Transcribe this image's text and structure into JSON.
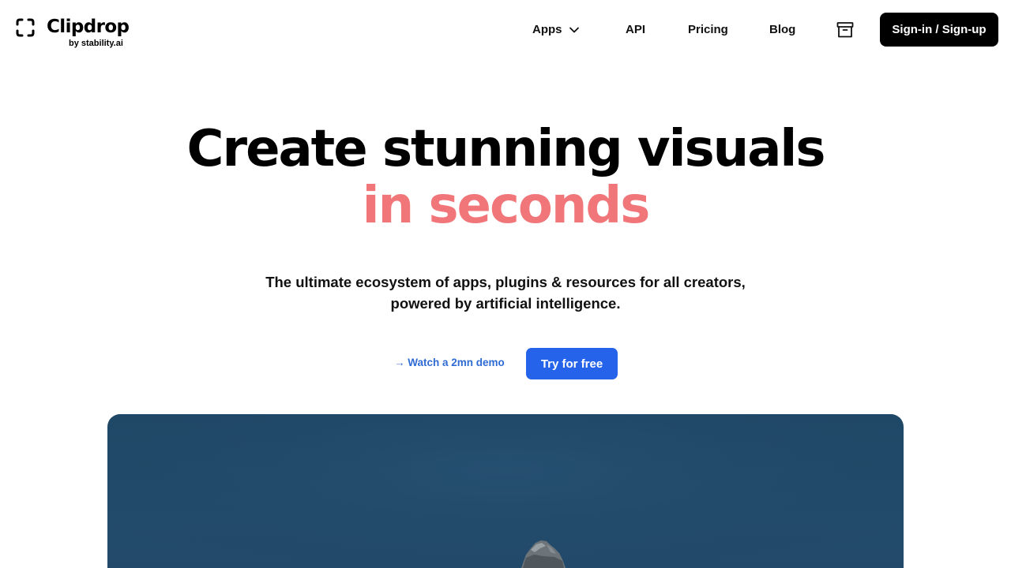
{
  "brand": {
    "name": "Clipdrop",
    "tagline": "by stability.ai",
    "logo_icon": "clipdrop-bracket-icon"
  },
  "nav": {
    "items": [
      {
        "label": "Apps",
        "has_dropdown": true,
        "icon": "chevron-down-icon"
      },
      {
        "label": "API"
      },
      {
        "label": "Pricing"
      },
      {
        "label": "Blog"
      }
    ],
    "archive_icon": "archive-box-icon",
    "signin_label": "Sign-in / Sign-up"
  },
  "hero": {
    "title_line1": "Create stunning visuals",
    "title_line2": "in seconds",
    "subtitle_line1": "The ultimate ecosystem of apps, plugins & resources for all creators,",
    "subtitle_line2": "powered by artificial intelligence.",
    "demo_link": "→ Watch a 2mn demo",
    "cta_label": "Try for free"
  },
  "colors": {
    "accent": "#f1767a",
    "primary_button": "#2563eb",
    "link": "#2f6bd4",
    "dark_button": "#000000",
    "image_background": "#214a6a"
  }
}
